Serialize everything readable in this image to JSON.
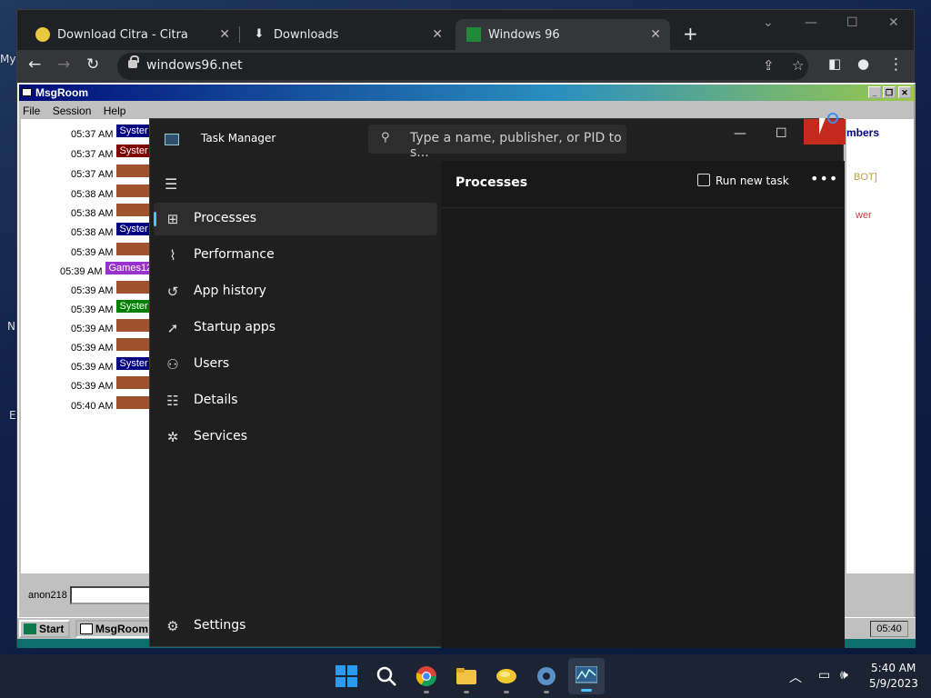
{
  "desktop": {
    "letters": [
      "My",
      "N",
      "E"
    ]
  },
  "browser": {
    "tabs": [
      {
        "title": "Download Citra - Citra",
        "icon": "citra-icon"
      },
      {
        "title": "Downloads",
        "icon": "download-icon"
      },
      {
        "title": "Windows 96",
        "icon": "windows96-icon"
      }
    ],
    "url": "windows96.net"
  },
  "msgroom": {
    "title": "MsgRoom",
    "menu": [
      "File",
      "Session",
      "Help"
    ],
    "messages": [
      {
        "time": "05:37 AM",
        "user": "Syster",
        "color": "#000080"
      },
      {
        "time": "05:37 AM",
        "user": "Syster",
        "color": "#800000"
      },
      {
        "time": "05:37 AM",
        "user": "",
        "color": "#a0522d"
      },
      {
        "time": "05:38 AM",
        "user": "",
        "color": "#a0522d"
      },
      {
        "time": "05:38 AM",
        "user": "",
        "color": "#a0522d"
      },
      {
        "time": "05:38 AM",
        "user": "Syster",
        "color": "#000080"
      },
      {
        "time": "05:39 AM",
        "user": "",
        "color": "#a0522d"
      },
      {
        "time": "05:39 AM",
        "user": "Games12",
        "color": "#9932cc"
      },
      {
        "time": "05:39 AM",
        "user": "",
        "color": "#a0522d"
      },
      {
        "time": "05:39 AM",
        "user": "Syster",
        "color": "#008000"
      },
      {
        "time": "05:39 AM",
        "user": "",
        "color": "#a0522d"
      },
      {
        "time": "05:39 AM",
        "user": "",
        "color": "#a0522d"
      },
      {
        "time": "05:39 AM",
        "user": "Syster",
        "color": "#000080"
      },
      {
        "time": "05:39 AM",
        "user": "",
        "color": "#a0522d"
      },
      {
        "time": "05:40 AM",
        "user": "",
        "color": "#a0522d"
      }
    ],
    "members_header": "mbers",
    "member_1": "BOT]",
    "member_2": "wer",
    "username": "anon218",
    "start_label": "Start",
    "taskbar_app": "MsgRoom",
    "clock": "05:40"
  },
  "taskmanager": {
    "title": "Task Manager",
    "search_placeholder": "Type a name, publisher, or PID to s...",
    "nav": [
      {
        "label": "Processes",
        "icon": "processes-icon",
        "active": true
      },
      {
        "label": "Performance",
        "icon": "performance-icon"
      },
      {
        "label": "App history",
        "icon": "app-history-icon"
      },
      {
        "label": "Startup apps",
        "icon": "startup-apps-icon"
      },
      {
        "label": "Users",
        "icon": "users-icon"
      },
      {
        "label": "Details",
        "icon": "details-icon"
      },
      {
        "label": "Services",
        "icon": "services-icon"
      }
    ],
    "settings_label": "Settings",
    "page_title": "Processes",
    "run_new_task": "Run new task"
  },
  "taskbar": {
    "time": "5:40 AM",
    "date": "5/9/2023"
  }
}
